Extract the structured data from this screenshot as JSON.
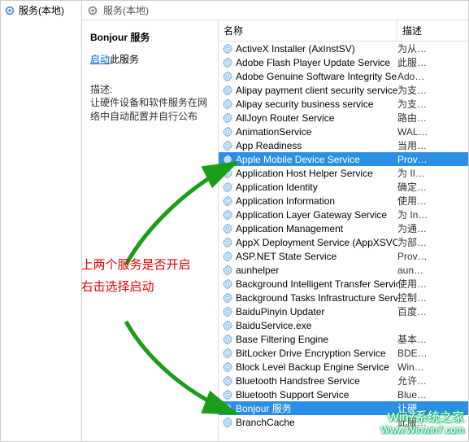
{
  "left_tree": {
    "label": "服务(本地)"
  },
  "topbar": {
    "label": "服务(本地)"
  },
  "side": {
    "title": "Bonjour 服务",
    "action_link": "启动",
    "action_suffix": "此服务",
    "desc_label": "描述:",
    "desc_text": "让硬件设备和软件服务在网络中自动配置并自行公布"
  },
  "annotation": {
    "line1": "检查以上两个服务是否开启",
    "line2": "右击选择启动"
  },
  "columns": {
    "name": "名称",
    "desc": "描述"
  },
  "services": [
    {
      "name": "ActiveX Installer (AxInstSV)",
      "desc": "为从…",
      "selected": false
    },
    {
      "name": "Adobe Flash Player Update Service",
      "desc": "此服…",
      "selected": false
    },
    {
      "name": "Adobe Genuine Software Integrity Service",
      "desc": "Ado…",
      "selected": false
    },
    {
      "name": "Alipay payment client security service",
      "desc": "为支…",
      "selected": false
    },
    {
      "name": "Alipay security business service",
      "desc": "为支…",
      "selected": false
    },
    {
      "name": "AllJoyn Router Service",
      "desc": "路由…",
      "selected": false
    },
    {
      "name": "AnimationService",
      "desc": "WAL…",
      "selected": false
    },
    {
      "name": "App Readiness",
      "desc": "当用…",
      "selected": false
    },
    {
      "name": "Apple Mobile Device Service",
      "desc": "Prov…",
      "selected": true
    },
    {
      "name": "Application Host Helper Service",
      "desc": "为 II…",
      "selected": false
    },
    {
      "name": "Application Identity",
      "desc": "确定…",
      "selected": false
    },
    {
      "name": "Application Information",
      "desc": "使用…",
      "selected": false
    },
    {
      "name": "Application Layer Gateway Service",
      "desc": "为 In…",
      "selected": false
    },
    {
      "name": "Application Management",
      "desc": "为通…",
      "selected": false
    },
    {
      "name": "AppX Deployment Service (AppXSVC)",
      "desc": "为部…",
      "selected": false
    },
    {
      "name": "ASP.NET State Service",
      "desc": "Prov…",
      "selected": false
    },
    {
      "name": "aunhelper",
      "desc": "aun…",
      "selected": false
    },
    {
      "name": "Background Intelligent Transfer Service",
      "desc": "使用…",
      "selected": false
    },
    {
      "name": "Background Tasks Infrastructure Service",
      "desc": "控制…",
      "selected": false
    },
    {
      "name": "BaiduPinyin Updater",
      "desc": "百度…",
      "selected": false
    },
    {
      "name": "BaiduService.exe",
      "desc": "",
      "selected": false
    },
    {
      "name": "Base Filtering Engine",
      "desc": "基本…",
      "selected": false
    },
    {
      "name": "BitLocker Drive Encryption Service",
      "desc": "BDE…",
      "selected": false
    },
    {
      "name": "Block Level Backup Engine Service",
      "desc": "Win…",
      "selected": false
    },
    {
      "name": "Bluetooth Handsfree Service",
      "desc": "允许…",
      "selected": false
    },
    {
      "name": "Bluetooth Support Service",
      "desc": "Blue…",
      "selected": false
    },
    {
      "name": "Bonjour 服务",
      "desc": "让硬…",
      "selected": true
    },
    {
      "name": "BranchCache",
      "desc": "此服…",
      "selected": false
    }
  ],
  "watermark": {
    "line1": "Win7系统之家",
    "line2": "Www.Winwin7.com"
  }
}
